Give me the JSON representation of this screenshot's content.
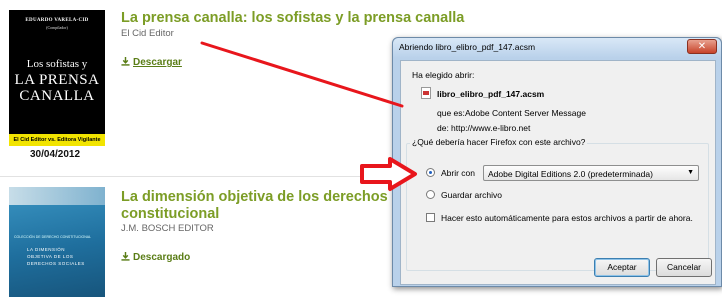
{
  "books": [
    {
      "cover": {
        "author": "EDUARDO VARELA-CID",
        "editor_small": "(Compilador)",
        "subtitle": "Los sofistas y",
        "main1": "LA PRENSA",
        "main2": "CANALLA",
        "band": "El Cid Editor vs. Editora Vigilante"
      },
      "date": "30/04/2012",
      "title": "La prensa canalla: los sofistas y la prensa canalla",
      "publisher": "El Cid Editor",
      "action": "Descargar"
    },
    {
      "cover": {
        "tag": "COLECCIÓN DE DERECHO CONSTITUCIONAL",
        "t1": "LA DIMENSIÓN",
        "t2": "OBJETIVA DE LOS",
        "t3": "DERECHOS SOCIALES"
      },
      "title_line1": "La dimensión objetiva de los derechos so",
      "title_line2": "constitucional",
      "publisher": "J.M. BOSCH EDITOR",
      "action": "Descargado"
    }
  ],
  "dialog": {
    "title": "Abriendo libro_elibro_pdf_147.acsm",
    "close_label": "✕",
    "opened_label": "Ha elegido abrir:",
    "filename": "libro_elibro_pdf_147.acsm",
    "type_label": "que es:",
    "type_value": "Adobe Content Server Message",
    "from_label": "de:",
    "from_value": "http://www.e-libro.net",
    "question": "¿Qué debería hacer Firefox con este archivo?",
    "open_with_label": "Abrir con",
    "open_with_app": "Adobe Digital Editions 2.0 (predeterminada)",
    "save_label": "Guardar archivo",
    "auto_label": "Hacer esto automáticamente para estos archivos a partir de ahora.",
    "accept_label": "Aceptar",
    "cancel_label": "Cancelar"
  },
  "colors": {
    "title_green": "#7c9d26",
    "annotation_red": "#e8161c",
    "dialog_frame": "#b9d1ea"
  }
}
